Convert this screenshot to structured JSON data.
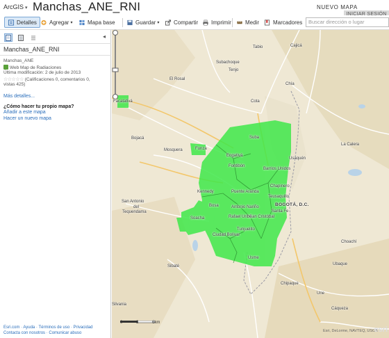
{
  "header": {
    "brand": "ArcGIS",
    "map_title": "Manchas_ANE_RNI",
    "new_map": "NUEVO MAPA",
    "sign_in": "INICIAR SESIÓN"
  },
  "toolbar": {
    "details": "Detalles",
    "add": "Agregar",
    "basemap": "Mapa base",
    "save": "Guardar",
    "share": "Compartir",
    "print": "Imprimir",
    "measure": "Medir",
    "bookmarks": "Marcadores",
    "search_placeholder": "Buscar dirección o lugar"
  },
  "sidebar": {
    "title": "Manchas_ANE_RNI",
    "item_name": "Manchas_ANE",
    "layer": "Web Map de Radiaciones",
    "modified": "Última modificación: 2 de julio de 2013",
    "ratings": "(Calificaciones 0, comentarios 0,",
    "views": "vistas 425)",
    "more_details": "Más detalles...",
    "have_map": "¿Cómo hacer tu propio mapa?",
    "add_to_map": "Añadir a este mapa",
    "make_new": "Hacer un nuevo mapa",
    "footer_line1": "Esri.com · Ayuda · Términos de uso · Privacidad",
    "footer_line2": "Contacta con nosotros · Comunicar abuso"
  },
  "map": {
    "places": {
      "subachoque": "Subachoque",
      "tabio": "Tabio",
      "cajica": "Cajicá",
      "tenjo": "Tenjo",
      "el_rosal": "El Rosal",
      "facatativa": "Facatativá",
      "cota": "Cota",
      "chia": "Chía",
      "bojaca": "Bojacá",
      "mosquera": "Mosquera",
      "funza": "Funza",
      "suba": "Suba",
      "engativa": "Engativá",
      "fontibon": "Fontibón",
      "barrios_unidos": "Barrios Unidos",
      "usaquen": "Usaquén",
      "la_calera": "La Calera",
      "kennedy": "Kennedy",
      "puente_aranda": "Puente Aranda",
      "chapinero": "Chapinero",
      "teusaquillo": "Teusaquillo",
      "bogota": "BOGOTÁ, D.C.",
      "san_antonio": "San Antonio",
      "del": "del",
      "tequendama": "Tequendama",
      "bosa": "Bosa",
      "antonio_narino": "Antonio Nariño",
      "santa_fe": "Santa Fe",
      "san_cristobal": "San Cristóbal",
      "rafael_uribe": "Rafael Uribe",
      "soacha": "Soacha",
      "tunjuelito": "Tunjuelito",
      "ciudad_bolivar": "Ciudad Bolívar",
      "choachi": "Choachí",
      "usme": "Usme",
      "sibate": "Sibaté",
      "ubaque": "Ubaque",
      "chipaque": "Chipaque",
      "silvania": "Silvania",
      "une": "Une",
      "caqueza": "Cáqueza"
    },
    "scale_0": "0",
    "scale_3": "3",
    "scale_6": "6km",
    "attribution": "Esri, DeLorme, NAVTEQ, USGS",
    "logo": "esri",
    "coverage_color": "#3fe84a"
  }
}
